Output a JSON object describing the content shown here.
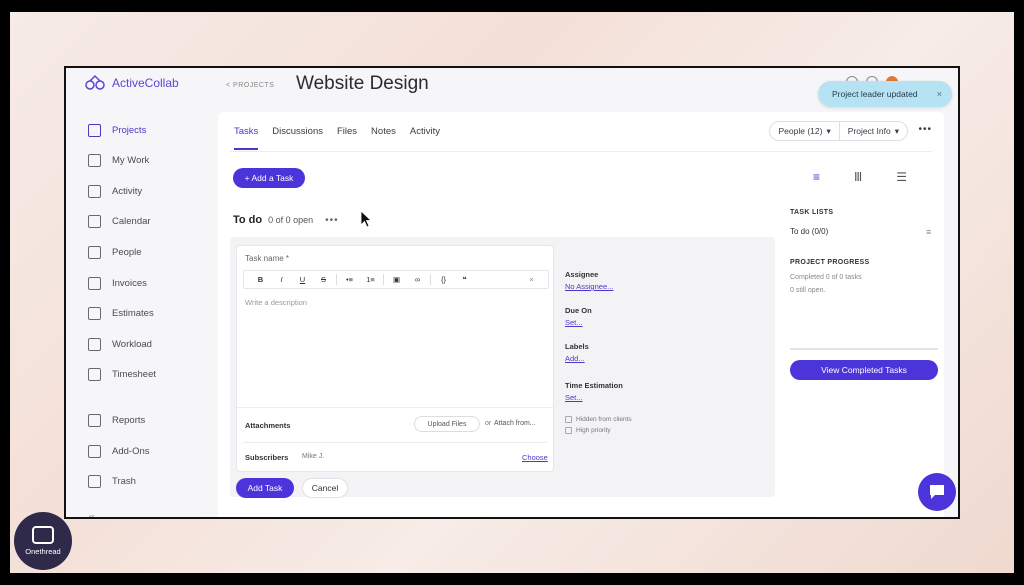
{
  "app": {
    "name": "ActiveCollab"
  },
  "sidebar": {
    "items": [
      {
        "label": "Projects",
        "icon": "grid-icon",
        "active": true
      },
      {
        "label": "My Work",
        "icon": "person-card-icon"
      },
      {
        "label": "Activity",
        "icon": "activity-icon"
      },
      {
        "label": "Calendar",
        "icon": "calendar-icon"
      },
      {
        "label": "People",
        "icon": "people-icon"
      },
      {
        "label": "Invoices",
        "icon": "invoice-icon"
      },
      {
        "label": "Estimates",
        "icon": "estimate-icon"
      },
      {
        "label": "Workload",
        "icon": "workload-icon"
      },
      {
        "label": "Timesheet",
        "icon": "timesheet-icon"
      },
      {
        "label": "Reports",
        "icon": "reports-icon"
      },
      {
        "label": "Add-Ons",
        "icon": "addons-icon"
      },
      {
        "label": "Trash",
        "icon": "trash-icon"
      }
    ]
  },
  "header": {
    "back_label": "< PROJECTS",
    "title": "Website Design",
    "toast": {
      "text": "Project leader updated",
      "close": "×"
    }
  },
  "tabs": [
    "Tasks",
    "Discussions",
    "Files",
    "Notes",
    "Activity"
  ],
  "active_tab": "Tasks",
  "header_actions": {
    "people": "People (12)",
    "project_info": "Project Info",
    "more": "•••"
  },
  "add_task_label": "+ Add a Task",
  "view_icons": {
    "list": "≡",
    "columns": "Ⅲ",
    "timeline": "☰"
  },
  "todo": {
    "title": "To do",
    "count": "0 of 0 open",
    "more": "•••"
  },
  "task_form": {
    "name_label": "Task name *",
    "toolbar": [
      "B",
      "I",
      "U",
      "S",
      "•≡",
      "1≡",
      "▣",
      "∞",
      "{}",
      "❝"
    ],
    "toolbar_close": "×",
    "description_placeholder": "Write a description",
    "attachments_label": "Attachments",
    "upload_label": "Upload Files",
    "or_text": "or",
    "attach_from": "Attach from...",
    "subscribers_label": "Subscribers",
    "subscriber_name": "Mike J.",
    "choose_label": "Choose",
    "submit_label": "Add Task",
    "cancel_label": "Cancel"
  },
  "task_meta": {
    "assignee_label": "Assignee",
    "assignee_value": "No Assignee...",
    "due_label": "Due On",
    "due_value": "Set...",
    "labels_label": "Labels",
    "labels_value": "Add...",
    "estimate_label": "Time Estimation",
    "estimate_value": "Set...",
    "hidden_label": "Hidden from clients",
    "priority_label": "High priority"
  },
  "right_panel": {
    "task_lists_title": "TASK LISTS",
    "task_list_item": "To do (0/0)",
    "progress_title": "PROJECT PROGRESS",
    "completed_text": "Completed 0 of 0 tasks",
    "still_open_text": "0 still open.",
    "progress": 0,
    "view_completed_label": "View Completed Tasks"
  },
  "branding": {
    "label": "Onethread"
  },
  "colors": {
    "accent": "#4b34d9",
    "toast": "#b6e3f4"
  }
}
